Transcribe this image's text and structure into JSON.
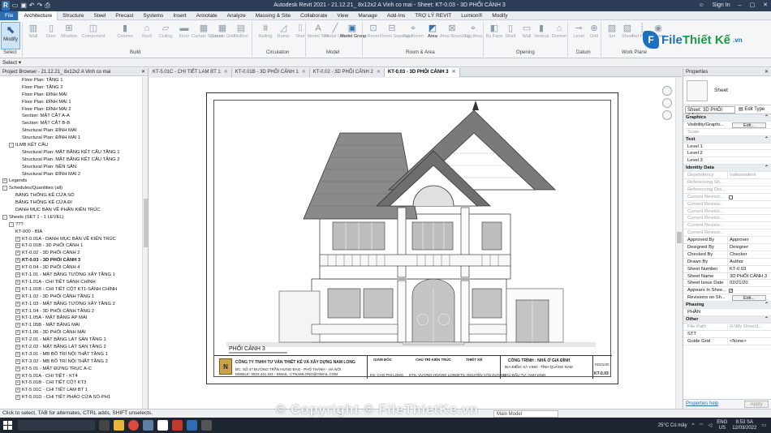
{
  "titlebar": {
    "title": "Autodesk Revit 2021 - 21.12.21_ 8x12x2 A Vinh co mai - Sheet: KT-0.03 - 3D PHỐI CẢNH 3",
    "sign_in": "Sign In"
  },
  "menu": [
    "File",
    "Architecture",
    "Structure",
    "Steel",
    "Precast",
    "Systems",
    "Insert",
    "Annotate",
    "Analyze",
    "Massing & Site",
    "Collaborate",
    "View",
    "Manage",
    "Add-Ins",
    "TRỢ LÝ REVIT",
    "Lumion®",
    "Modify"
  ],
  "ribbon": {
    "modify": "Modify",
    "buttons": [
      "Wall",
      "Door",
      "Window",
      "Component",
      "Column",
      "Roof",
      "Ceiling",
      "Floor",
      "Curtain System",
      "Curtain Grid",
      "Mullion",
      "Railing",
      "Ramp",
      "Stair",
      "Model Text",
      "Model Line",
      "Model Group",
      "Room",
      "Room Separator",
      "Tag Room",
      "Area",
      "Area Boundary",
      "Tag Area",
      "By Face",
      "Shaft",
      "Wall",
      "Vertical",
      "Dormer",
      "Level",
      "Grid",
      "Set",
      "Show",
      "Ref Plane",
      "Viewer"
    ],
    "panels": [
      "Select",
      "Build",
      "Circulation",
      "Model",
      "Room & Area",
      "Opening",
      "Datum",
      "Work Plane"
    ]
  },
  "logo": {
    "brand_a": "File",
    "brand_b": "Thiết Kế",
    "domain": ".vn",
    "mark": "F"
  },
  "project_browser": {
    "title": "Project Browser - 21.12.21_ 8x12x2 A Vinh co mai",
    "rows": [
      {
        "text": "Floor Plan: TẦNG 1",
        "indent": 3
      },
      {
        "text": "Floor Plan: TẦNG 2",
        "indent": 3
      },
      {
        "text": "Floor Plan: ĐỈNH MÁI",
        "indent": 3
      },
      {
        "text": "Floor Plan: ĐỈNH MÁI 1",
        "indent": 3
      },
      {
        "text": "Floor Plan: ĐỈNH MÁI 2",
        "indent": 3
      },
      {
        "text": "Section: MẶT CẮT A-A",
        "indent": 3
      },
      {
        "text": "Section: MẶT CẮT B-B",
        "indent": 3
      },
      {
        "text": "Structural Plan: ĐỈNH MÁI",
        "indent": 3
      },
      {
        "text": "Structural Plan: ĐỈNH MÁI 1",
        "indent": 3
      },
      {
        "text": "ILMB KẾT CẤU",
        "indent": 1,
        "toggle": "-"
      },
      {
        "text": "Structural Plan: MẶT BẰNG KẾT CẤU TẦNG 1",
        "indent": 3
      },
      {
        "text": "Structural Plan: MẶT BẰNG KẾT CẤU TẦNG 2",
        "indent": 3
      },
      {
        "text": "Structural Plan: NỀN SÂN",
        "indent": 3
      },
      {
        "text": "Structural Plan: ĐỈNH MÁI 2",
        "indent": 3
      },
      {
        "text": "Legends",
        "indent": 0,
        "toggle": "+"
      },
      {
        "text": "Schedules/Quantities (all)",
        "indent": 0,
        "toggle": "-"
      },
      {
        "text": "BẢNG THỐNG KÊ CỬA SỔ",
        "indent": 2
      },
      {
        "text": "BẢNG THỐNG KÊ CỬA ĐI",
        "indent": 2
      },
      {
        "text": "DANH MỤC BẢN VẼ PHẦN KIẾN TRÚC",
        "indent": 2
      },
      {
        "text": "Sheets (SET 1 - 1 LEVEL)",
        "indent": 0,
        "toggle": "-"
      },
      {
        "text": "???",
        "indent": 1,
        "toggle": "-"
      },
      {
        "text": "KT-000 - BÌA",
        "indent": 2
      },
      {
        "text": "KT-0.01A - DANH MỤC BẢN VẼ KIẾN TRÚC",
        "indent": 2,
        "toggle": "+"
      },
      {
        "text": "KT-0.01B - 3D PHỐI CẢNH 1",
        "indent": 2,
        "toggle": "+"
      },
      {
        "text": "KT-0.02 - 3D PHỐI CẢNH 2",
        "indent": 2,
        "toggle": "+"
      },
      {
        "text": "KT-0.03 - 3D PHỐI CẢNH 3",
        "indent": 2,
        "toggle": "+",
        "bold": true
      },
      {
        "text": "KT-0.04 - 3D PHỐI CẢNH 4",
        "indent": 2,
        "toggle": "+"
      },
      {
        "text": "KT-1.01 - MẶT BẰNG TƯỜNG XÂY TẦNG 1",
        "indent": 2,
        "toggle": "+"
      },
      {
        "text": "KT-1.01A - CHI TIẾT SẢNH CHÍNH",
        "indent": 2,
        "toggle": "+"
      },
      {
        "text": "KT-1.01B - CHI TIẾT CỘT KT1-SẢNH CHÍNH",
        "indent": 2,
        "toggle": "+"
      },
      {
        "text": "KT-1.02 - 3D PHỐI CẢNH TẦNG 1",
        "indent": 2,
        "toggle": "+"
      },
      {
        "text": "KT-1.03 - MẶT BẰNG TƯỜNG XÂY TẦNG 2",
        "indent": 2,
        "toggle": "+"
      },
      {
        "text": "KT-1.04 - 3D PHỐI CẢNH TẦNG 2",
        "indent": 2,
        "toggle": "+"
      },
      {
        "text": "KT-1.05A - MẶT BẰNG ÁP MÁI",
        "indent": 2,
        "toggle": "+"
      },
      {
        "text": "KT-1.05B - MẶT BẰNG MÁI",
        "indent": 2,
        "toggle": "+"
      },
      {
        "text": "KT-1.06 - 3D PHỐI CẢNH MÁI",
        "indent": 2,
        "toggle": "+"
      },
      {
        "text": "KT-2.01 - MẶT BẰNG LÁT SÀN TẦNG 1",
        "indent": 2,
        "toggle": "+"
      },
      {
        "text": "KT-2.02 - MẶT BẰNG LÁT SÀN TẦNG 2",
        "indent": 2,
        "toggle": "+"
      },
      {
        "text": "KT-3.01 - MB BỐ TRÍ NỘI THẤT TẦNG 1",
        "indent": 2,
        "toggle": "+"
      },
      {
        "text": "KT-3.02 - MB BỐ TRÍ NỘI THẤT TẦNG 2",
        "indent": 2,
        "toggle": "+"
      },
      {
        "text": "KT-5.01 - MẶT ĐỨNG TRỤC A-C",
        "indent": 2,
        "toggle": "+"
      },
      {
        "text": "KT-5.01A - CHI TIẾT - KT4",
        "indent": 2,
        "toggle": "+"
      },
      {
        "text": "KT-5.01B - CHI TIẾT CỘT KT3",
        "indent": 2,
        "toggle": "+"
      },
      {
        "text": "KT-5.01C - CHI TIẾT LAM BT 1",
        "indent": 2,
        "toggle": "+"
      },
      {
        "text": "KT-5.01D - CHI TIẾT PHÀO CỬA SỔ-PH1",
        "indent": 2,
        "toggle": "+"
      }
    ]
  },
  "view_tabs": [
    {
      "label": "KT-5.01C - CHI TIẾT LAM BT 1",
      "active": false
    },
    {
      "label": "KT-0.01B - 3D PHỐI CẢNH 1",
      "active": false
    },
    {
      "label": "KT-0.02 - 3D PHỐI CẢNH 2",
      "active": false
    },
    {
      "label": "KT-0.03 - 3D PHỐI CẢNH 3",
      "active": true
    }
  ],
  "sheet": {
    "view_title": "PHỐI CẢNH 3",
    "company": "CÔNG TY TNHH TƯ VẤN THIẾT KẾ VÀ XÂY DỰNG NAM LONG",
    "company_addr": "ĐC: SỐ 47 ĐƯỜNG TRẦN HƯNG ĐẠO - PHỐ THÀNH - HÀ NỘI",
    "company_contact": "MOBILE: 0923.441.331 - EMAIL: CTNAMLONG@GMAIL.COM",
    "roles": [
      "GIÁM ĐỐC",
      "CHỦ TRÌ KIẾN TRÚC",
      "THIẾT KẾ"
    ],
    "names": [
      "KS. CAO PHI LONG",
      "KTS. VƯƠNG HOÀNG LONG",
      "KTS. NGUYỄN VĂN DƯƠNG"
    ],
    "project_title": "CÔNG TRÌNH : NHÀ Ở GIA ĐÌNH",
    "project_sub": "ĐỊA ĐIỂM: XÃ VINH - TỈNH QUẢNG NAM",
    "owner": "CHỦ ĐẦU TƯ: ANH VINH",
    "date": "02/21/20",
    "sheet_number": "KT-0.03"
  },
  "properties": {
    "title": "Properties",
    "type_name": "Sheet",
    "selector": "Sheet: 3D PHỐI CẢNI",
    "edit_type": "Edit Type",
    "rows": [
      {
        "k": "Graphics",
        "section": true
      },
      {
        "k": "Visibility/Graphi...",
        "btn": "Edit..."
      },
      {
        "k": "Scale",
        "v": "",
        "dim": true
      },
      {
        "k": "Text",
        "section": true
      },
      {
        "k": "Level 1",
        "v": ""
      },
      {
        "k": "Level 2",
        "v": ""
      },
      {
        "k": "Level 3",
        "v": ""
      },
      {
        "k": "Identity Data",
        "section": true
      },
      {
        "k": "Dependency",
        "v": "Independent",
        "dim": true
      },
      {
        "k": "Referencing Sh...",
        "v": "",
        "dim": true
      },
      {
        "k": "Referencing Det...",
        "v": "",
        "dim": true
      },
      {
        "k": "Current Revisio...",
        "v": "",
        "dim": true,
        "check": ""
      },
      {
        "k": "Current Revisio...",
        "v": "",
        "dim": true
      },
      {
        "k": "Current Revisio...",
        "v": "",
        "dim": true
      },
      {
        "k": "Current Revisio...",
        "v": "",
        "dim": true
      },
      {
        "k": "Current Revisio...",
        "v": "",
        "dim": true
      },
      {
        "k": "Current Revisio...",
        "v": "",
        "dim": true
      },
      {
        "k": "Approved By",
        "v": "Approver"
      },
      {
        "k": "Designed By",
        "v": "Designer"
      },
      {
        "k": "Checked By",
        "v": "Checker"
      },
      {
        "k": "Drawn By",
        "v": "Author"
      },
      {
        "k": "Sheet Number",
        "v": "KT-0.03"
      },
      {
        "k": "Sheet Name",
        "v": "3D PHỐI CẢNH 3"
      },
      {
        "k": "Sheet Issue Date",
        "v": "02/21/20"
      },
      {
        "k": "Appears In Shee...",
        "v": "",
        "check": "✓"
      },
      {
        "k": "Revisions on Sh...",
        "btn": "Edit..."
      },
      {
        "k": "Phasing",
        "section": true
      },
      {
        "k": "PHẦN",
        "v": ""
      },
      {
        "k": "Other",
        "section": true
      },
      {
        "k": "File Path",
        "v": "G:\\My Drive\\3...",
        "dim": true
      },
      {
        "k": "STT",
        "v": ""
      },
      {
        "k": "Guide Grid",
        "v": "<None>"
      }
    ],
    "help": "Properties help",
    "apply": "Apply"
  },
  "status": {
    "message": "Click to select, TAB for alternates, CTRL adds, SHIFT unselects.",
    "model": "Main Model"
  },
  "watermark": "© Copyright © FileThietKe.vn",
  "taskbar": {
    "weather": "25°C Có mây",
    "lang": "ENG",
    "lang2": "US",
    "time": "8:53 SA",
    "date": "12/03/2022"
  }
}
